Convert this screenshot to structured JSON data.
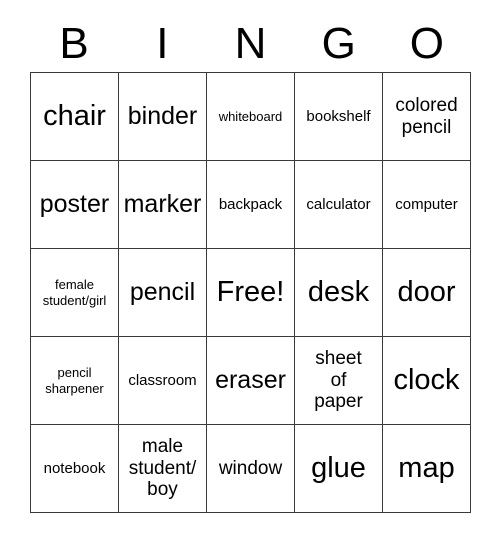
{
  "card": {
    "title_letters": [
      "B",
      "I",
      "N",
      "G",
      "O"
    ],
    "free_space_label": "Free!",
    "colors": {
      "background": "#ffffff",
      "text": "#000000",
      "grid_line": "#3a3a3a"
    },
    "grid": {
      "columns": 5,
      "rows": 5,
      "cells": [
        {
          "text": "chair",
          "size": "xl"
        },
        {
          "text": "binder",
          "size": "lg"
        },
        {
          "text": "whiteboard",
          "size": "xs"
        },
        {
          "text": "bookshelf",
          "size": "sm"
        },
        {
          "text": "colored\npencil",
          "size": "md"
        },
        {
          "text": "poster",
          "size": "lg"
        },
        {
          "text": "marker",
          "size": "lg"
        },
        {
          "text": "backpack",
          "size": "sm"
        },
        {
          "text": "calculator",
          "size": "sm"
        },
        {
          "text": "computer",
          "size": "sm"
        },
        {
          "text": "female\nstudent/girl",
          "size": "xs"
        },
        {
          "text": "pencil",
          "size": "lg"
        },
        {
          "text": "Free!",
          "size": "xl"
        },
        {
          "text": "desk",
          "size": "xl"
        },
        {
          "text": "door",
          "size": "xl"
        },
        {
          "text": "pencil\nsharpener",
          "size": "xs"
        },
        {
          "text": "classroom",
          "size": "sm"
        },
        {
          "text": "eraser",
          "size": "lg"
        },
        {
          "text": "sheet\nof\npaper",
          "size": "md"
        },
        {
          "text": "clock",
          "size": "xl"
        },
        {
          "text": "notebook",
          "size": "sm"
        },
        {
          "text": "male\nstudent/\nboy",
          "size": "md"
        },
        {
          "text": "window",
          "size": "md"
        },
        {
          "text": "glue",
          "size": "xl"
        },
        {
          "text": "map",
          "size": "xl"
        }
      ]
    }
  }
}
